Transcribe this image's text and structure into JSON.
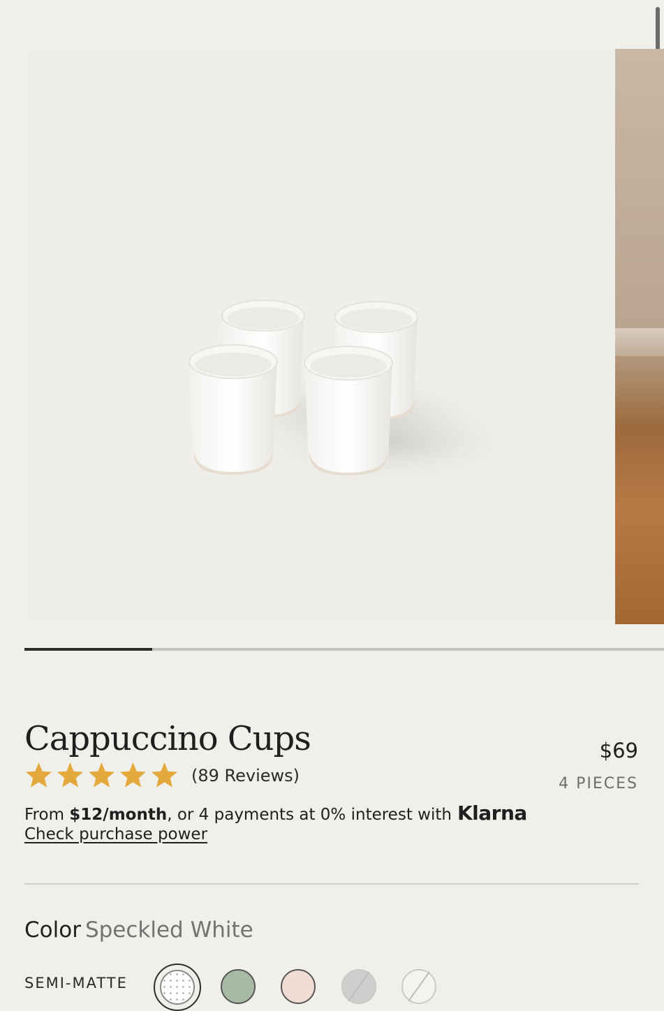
{
  "product": {
    "title": "Cappuccino Cups",
    "price": "$69",
    "pieces": "4 PIECES",
    "rating": 5,
    "reviews_text": "(89 Reviews)"
  },
  "gallery": {
    "progress": 0.2,
    "image_alt": "Four white speckled cappuccino cups"
  },
  "financing": {
    "prefix": "From ",
    "monthly": "$12/month",
    "middle": ", or 4 payments at 0% interest with",
    "provider": "Klarna",
    "link": "Check purchase power"
  },
  "color": {
    "label": "Color",
    "selected": "Speckled White",
    "finish": "SEMI-MATTE",
    "swatches": [
      {
        "name": "Speckled White",
        "color": "#ffffff",
        "selected": true,
        "available": true
      },
      {
        "name": "Sage",
        "color": "#a8baa6",
        "selected": false,
        "available": true
      },
      {
        "name": "Blush",
        "color": "#f2ddd6",
        "selected": false,
        "available": true
      },
      {
        "name": "Grey",
        "color": "#cfcfcd",
        "selected": false,
        "available": false
      },
      {
        "name": "White",
        "color": "#f4f3ef",
        "selected": false,
        "available": false
      }
    ]
  },
  "colors": {
    "star": "#e4a93c",
    "background": "#f0efea"
  }
}
